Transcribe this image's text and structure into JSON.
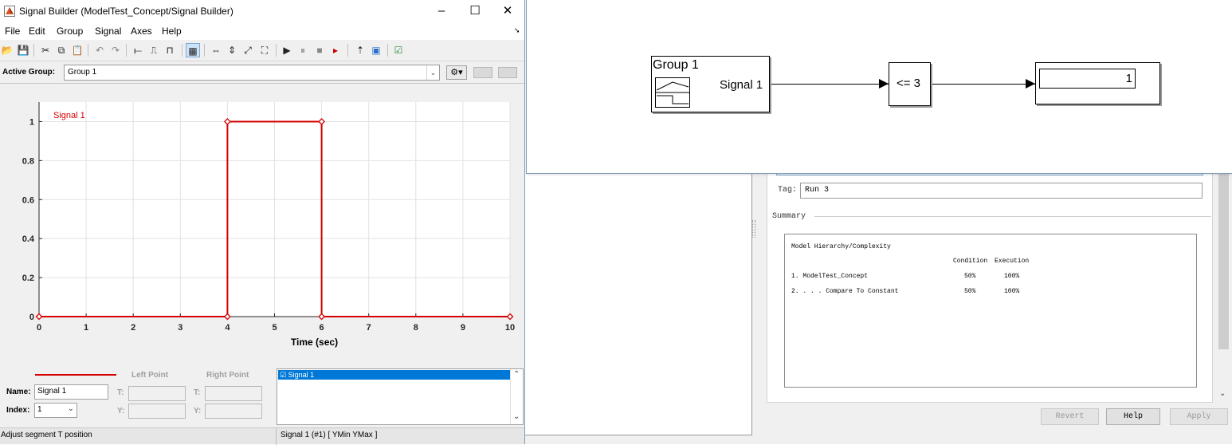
{
  "inspector": {
    "tag_label": "Tag:",
    "tag_value": "Run 3",
    "summary_label": "Summary",
    "report_title": "Model Hierarchy/Complexity",
    "col_condition": "Condition",
    "col_execution": "Execution",
    "rows": [
      {
        "name": "1. ModelTest_Concept",
        "condition": "50%",
        "execution": "100%"
      },
      {
        "name": "2. . . . Compare To Constant",
        "condition": "50%",
        "execution": "100%"
      }
    ],
    "buttons": {
      "revert": "Revert",
      "help": "Help",
      "apply": "Apply"
    }
  },
  "model": {
    "group_block_title": "Group 1",
    "group_block_port": "Signal 1",
    "compare_block": "<= 3",
    "display_value": "1"
  },
  "signal_builder": {
    "title": "Signal Builder (ModelTest_Concept/Signal Builder)",
    "window_buttons": {
      "minimize": "–",
      "maximize": "☐",
      "close": "✕"
    },
    "menu": [
      "File",
      "Edit",
      "Group",
      "Signal",
      "Axes",
      "Help"
    ],
    "active_group_label": "Active Group:",
    "active_group_value": "Group 1",
    "name_label": "Name:",
    "name_value": "Signal 1",
    "index_label": "Index:",
    "index_value": "1",
    "left_point": "Left Point",
    "right_point": "Right Point",
    "t_label": "T:",
    "y_label": "Y:",
    "signal_list_item": "☑ Signal 1",
    "status_left": "Adjust segment T position",
    "status_right": "Signal 1 (#1)  [ YMin YMax ]"
  },
  "chart_data": {
    "type": "line",
    "title": "",
    "xlabel": "Time (sec)",
    "ylabel": "",
    "xlim": [
      0,
      10
    ],
    "ylim": [
      0,
      1.1
    ],
    "xticks": [
      0,
      1,
      2,
      3,
      4,
      5,
      6,
      7,
      8,
      9,
      10
    ],
    "yticks": [
      0,
      0.2,
      0.4,
      0.6,
      0.8,
      1
    ],
    "grid": true,
    "series": [
      {
        "name": "Signal 1",
        "color": "#d40000",
        "x": [
          0,
          4,
          4,
          6,
          6,
          10
        ],
        "y": [
          0,
          0,
          1,
          1,
          0,
          0
        ]
      }
    ]
  }
}
